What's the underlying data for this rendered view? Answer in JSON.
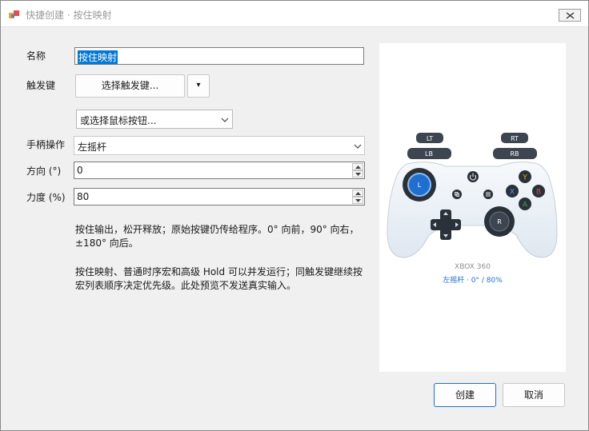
{
  "window": {
    "title": "快捷创建 · 按住映射"
  },
  "form": {
    "name_label": "名称",
    "name_value": "按住映射",
    "trigger_label": "触发键",
    "trigger_button": "选择触发键...",
    "trigger_dropdown_glyph": "▾",
    "mouse_combo_value": "或选择鼠标按钮...",
    "gamepad_label": "手柄操作",
    "gamepad_value": "左摇杆",
    "direction_label": "方向 (°)",
    "direction_value": "0",
    "force_label": "力度 (%)",
    "force_value": "80"
  },
  "description": {
    "line1": "按住输出，松开释放；原始按键仍传给程序。0° 向前，90° 向右，±180° 向后。",
    "line2": "按住映射、普通时序宏和高级 Hold 可以并发运行；同触发键继续按宏列表顺序决定优先级。此处预览不发送真实输入。"
  },
  "preview": {
    "buttons": {
      "lt": "LT",
      "rt": "RT",
      "lb": "LB",
      "rb": "RB",
      "ls": "L",
      "rs": "R",
      "y": "Y",
      "x": "X",
      "b": "B",
      "a": "A"
    },
    "model": "XBOX 360",
    "status": "左摇杆 · 0° / 80%",
    "colors": {
      "stick_active": "#1f6fd1",
      "y": "#e4b400",
      "x": "#2a6fd6",
      "b": "#e04848",
      "a": "#37a84a"
    }
  },
  "actions": {
    "create": "创建",
    "cancel": "取消"
  }
}
